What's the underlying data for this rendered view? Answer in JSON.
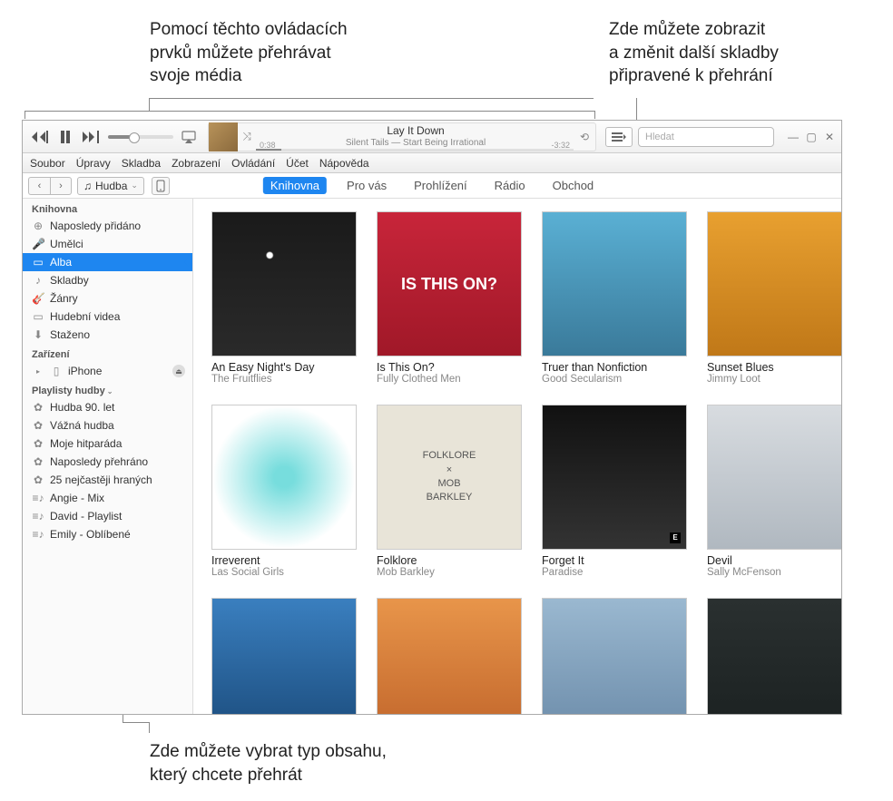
{
  "callouts": {
    "top_left": "Pomocí těchto ovládacích\nprvků můžete přehrávat\nsvoje média",
    "top_right": "Zde můžete zobrazit\na změnit další skladby\npřipravené k přehrání",
    "bottom": "Zde můžete vybrat typ obsahu,\nkterý chcete přehrát"
  },
  "now_playing": {
    "title": "Lay It Down",
    "subtitle": "Silent Tails — Start Being Irrational",
    "elapsed": "0:38",
    "remaining": "-3:32"
  },
  "search": {
    "placeholder": "Hledat"
  },
  "menu": [
    "Soubor",
    "Úpravy",
    "Skladba",
    "Zobrazení",
    "Ovládání",
    "Účet",
    "Nápověda"
  ],
  "media_picker": "Hudba",
  "tabs": [
    "Knihovna",
    "Pro vás",
    "Prohlížení",
    "Rádio",
    "Obchod"
  ],
  "sidebar": {
    "heading_library": "Knihovna",
    "library": [
      "Naposledy přidáno",
      "Umělci",
      "Alba",
      "Skladby",
      "Žánry",
      "Hudební videa",
      "Staženo"
    ],
    "heading_devices": "Zařízení",
    "devices": [
      "iPhone"
    ],
    "heading_playlists": "Playlisty hudby",
    "playlists": [
      "Hudba 90. let",
      "Vážná hudba",
      "Moje hitparáda",
      "Naposledy přehráno",
      "25 nejčastěji hraných",
      "Angie - Mix",
      "David - Playlist",
      "Emily - Oblíbené"
    ]
  },
  "albums": [
    {
      "title": "An Easy Night's Day",
      "artist": "The Fruitflies"
    },
    {
      "title": "Is This On?",
      "artist": "Fully Clothed Men"
    },
    {
      "title": "Truer than Nonfiction",
      "artist": "Good Secularism"
    },
    {
      "title": "Sunset Blues",
      "artist": "Jimmy Loot"
    },
    {
      "title": "Irreverent",
      "artist": "Las Social Girls"
    },
    {
      "title": "Folklore",
      "artist": "Mob Barkley"
    },
    {
      "title": "Forget It",
      "artist": "Paradise"
    },
    {
      "title": "Devil",
      "artist": "Sally McFenson"
    },
    {
      "title": "",
      "artist": ""
    },
    {
      "title": "",
      "artist": ""
    },
    {
      "title": "",
      "artist": ""
    },
    {
      "title": "",
      "artist": ""
    }
  ]
}
